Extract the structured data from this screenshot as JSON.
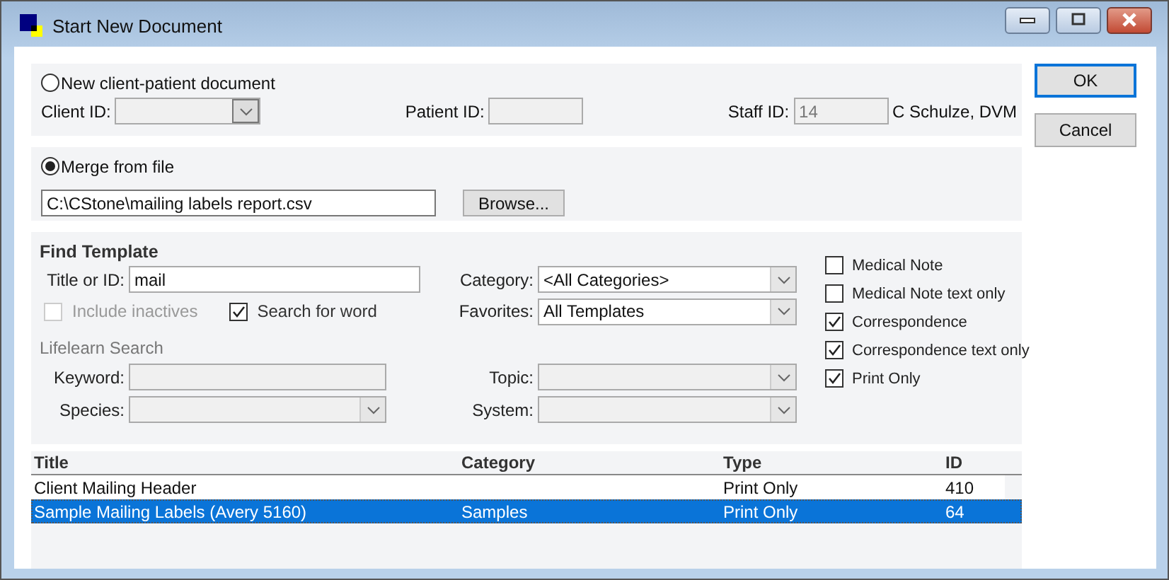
{
  "window": {
    "title": "Start New Document"
  },
  "new_document": {
    "label": "New client-patient document",
    "selected": false,
    "client_id_label": "Client ID:",
    "patient_id_label": "Patient ID:",
    "staff_id_label": "Staff ID:",
    "staff_id": "14",
    "staff_name": "C Schulze, DVM"
  },
  "merge": {
    "label": "Merge from file",
    "selected": true,
    "file_path": "C:\\CStone\\mailing labels report.csv",
    "browse_button": "Browse..."
  },
  "find_template": {
    "heading": "Find Template",
    "title_label": "Title or ID:",
    "title_value": "mail",
    "options": [
      {
        "label": "Include inactives",
        "checked": false,
        "disabled": true
      },
      {
        "label": "Search for word",
        "checked": true,
        "disabled": false
      }
    ],
    "category_label": "Category:",
    "category_value": "<All Categories>",
    "favorites_label": "Favorites:",
    "favorites_value": "All Templates",
    "lifelearn_heading": "Lifelearn Search",
    "keyword_label": "Keyword:",
    "species_label": "Species:",
    "topic_label": "Topic:",
    "system_label": "System:",
    "types": [
      {
        "label": "Medical Note",
        "checked": false
      },
      {
        "label": "Medical Note text only",
        "checked": false
      },
      {
        "label": "Correspondence",
        "checked": true
      },
      {
        "label": "Correspondence text only",
        "checked": true
      },
      {
        "label": "Print Only",
        "checked": true
      }
    ]
  },
  "table": {
    "columns": [
      "Title",
      "Category",
      "Type",
      "ID"
    ],
    "rows": [
      {
        "cells": [
          "Client Mailing Header",
          "",
          "Print Only",
          "410"
        ],
        "selected": false
      },
      {
        "cells": [
          "Sample Mailing Labels (Avery 5160)",
          "Samples",
          "Print Only",
          "64"
        ],
        "selected": true
      }
    ]
  },
  "buttons": [
    {
      "label": "OK",
      "default": true
    },
    {
      "label": "Cancel",
      "default": false
    }
  ]
}
